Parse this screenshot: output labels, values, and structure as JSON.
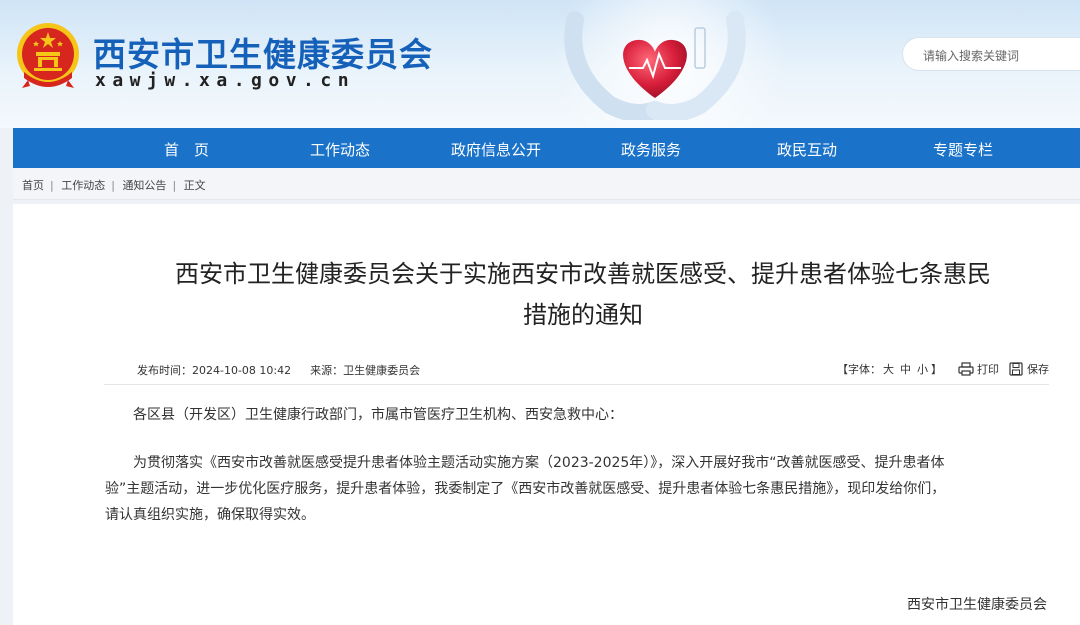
{
  "header": {
    "site_title": "西安市卫生健康委员会",
    "site_domain": "xawjw.xa.gov.cn",
    "search_placeholder": "请输入搜索关键词"
  },
  "nav": {
    "items": [
      {
        "label": "首　页"
      },
      {
        "label": "工作动态"
      },
      {
        "label": "政府信息公开"
      },
      {
        "label": "政务服务"
      },
      {
        "label": "政民互动"
      },
      {
        "label": "专题专栏"
      }
    ]
  },
  "breadcrumb": {
    "items": [
      "首页",
      "工作动态",
      "通知公告",
      "正文"
    ],
    "separator": "|"
  },
  "article": {
    "title_line1": "西安市卫生健康委员会关于实施西安市改善就医感受、提升患者体验七条惠民",
    "title_line2": "措施的通知",
    "publish_label": "发布时间：",
    "publish_time": "2024-10-08 10:42",
    "source_label": "来源：",
    "source": "卫生健康委员会",
    "font_size_label": "【字体：",
    "font_large": "大",
    "font_medium": "中",
    "font_small": "小",
    "font_close": "】",
    "print_label": "打印",
    "save_label": "保存",
    "greeting": "各区县（开发区）卫生健康行政部门，市属市管医疗卫生机构、西安急救中心：",
    "paragraph_line1": "为贯彻落实《西安市改善就医感受提升患者体验主题活动实施方案（2023-2025年）》，深入开展好我市“改善就医感受、提升患者体",
    "paragraph_line2": "验”主题活动，进一步优化医疗服务，提升患者体验，我委制定了《西安市改善就医感受、提升患者体验七条惠民措施》，现印发给你们，",
    "paragraph_line3": "请认真组织实施，确保取得实效。",
    "signature": "西安市卫生健康委员会"
  },
  "colors": {
    "nav_bg": "#1a73c9",
    "title_blue": "#1560b8",
    "emblem_red": "#d7261e",
    "emblem_gold": "#f5c518"
  }
}
